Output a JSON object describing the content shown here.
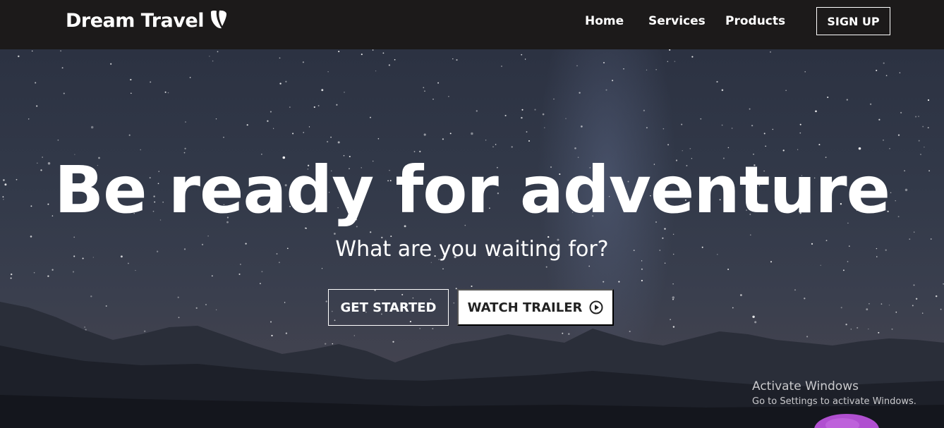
{
  "navbar": {
    "brand": "Dream Travel",
    "brand_icon": "typo3-icon",
    "links": [
      "Home",
      "Services",
      "Products"
    ],
    "signup_label": "SIGN UP"
  },
  "hero": {
    "headline": "Be ready for adventure",
    "subheadline": "What are you waiting for?",
    "get_started_label": "GET STARTED",
    "watch_trailer_label": "WATCH TRAILER",
    "watch_trailer_icon": "play-circle-icon"
  },
  "os_watermark": {
    "title": "Activate Windows",
    "subtitle": "Go to Settings to activate Windows."
  },
  "colors": {
    "navbar_bg": "#1c1a1a",
    "text": "#ffffff",
    "button_fill": "#ffffff",
    "tent": "#b04fd0"
  }
}
